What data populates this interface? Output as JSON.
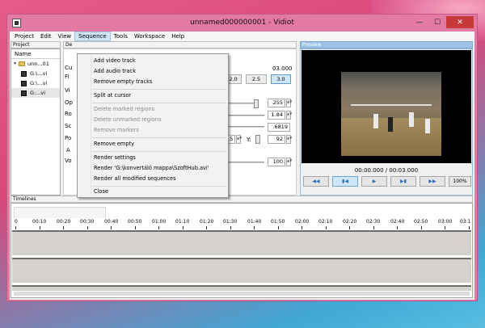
{
  "window": {
    "title": "unnamed000000001 - Vidiot"
  },
  "menubar": {
    "items": [
      {
        "label": "Project"
      },
      {
        "label": "Edit"
      },
      {
        "label": "View"
      },
      {
        "label": "Sequence"
      },
      {
        "label": "Tools"
      },
      {
        "label": "Workspace"
      },
      {
        "label": "Help"
      }
    ]
  },
  "project_panel": {
    "title": "Project",
    "header": "Name",
    "items": [
      "unn...01",
      "G:\\...vi",
      "G:\\...vi",
      "G:...vi"
    ]
  },
  "details_panel": {
    "title": "De",
    "labels": [
      "Cu",
      "Fi",
      "Vi",
      "Op",
      "Ro",
      "Sc",
      "Po",
      "A",
      "Vo"
    ],
    "duration": "03.000",
    "zoom_buttons": [
      "2.0",
      "2.5",
      "3.0"
    ],
    "values": {
      "opacity": "255",
      "rotation": "1.84",
      "scale": ".6819",
      "pos_x": "115",
      "y_label": "Y:",
      "pos_y": "92",
      "volume": "100"
    }
  },
  "preview_panel": {
    "title": "Preview",
    "time": "00:00.000 / 00:03.000",
    "zoom": "100%"
  },
  "timelines_panel": {
    "title": "Timelines",
    "ticks": [
      "0",
      "00:10",
      "00:20",
      "00:30",
      "00:40",
      "00:50",
      "01:00",
      "01:10",
      "01:20",
      "01:30",
      "01:40",
      "01:50",
      "02:00",
      "02:10",
      "02:20",
      "02:30",
      "02:40",
      "02:50",
      "03:00",
      "03:1"
    ]
  },
  "sequence_menu": {
    "items": [
      {
        "label": "Add video track",
        "enabled": true
      },
      {
        "label": "Add audio track",
        "enabled": true
      },
      {
        "label": "Remove empty tracks",
        "enabled": true
      },
      {
        "label": "Split at cursor",
        "enabled": true
      },
      {
        "label": "Delete marked regions",
        "enabled": false
      },
      {
        "label": "Delete unmarked regions",
        "enabled": false
      },
      {
        "label": "Remove markers",
        "enabled": false
      },
      {
        "label": "Remove empty",
        "enabled": true
      },
      {
        "label": "Render settings",
        "enabled": true
      },
      {
        "label": "Render 'G:\\konvertáló mappa\\SzoftHub.avi'",
        "enabled": true
      },
      {
        "label": "Render all modified sequences",
        "enabled": true
      },
      {
        "label": "Close",
        "enabled": true
      }
    ]
  },
  "colors": {
    "titlebar": "#e27aa1",
    "close": "#c7383a",
    "accent_blue": "#9cc3e6"
  }
}
